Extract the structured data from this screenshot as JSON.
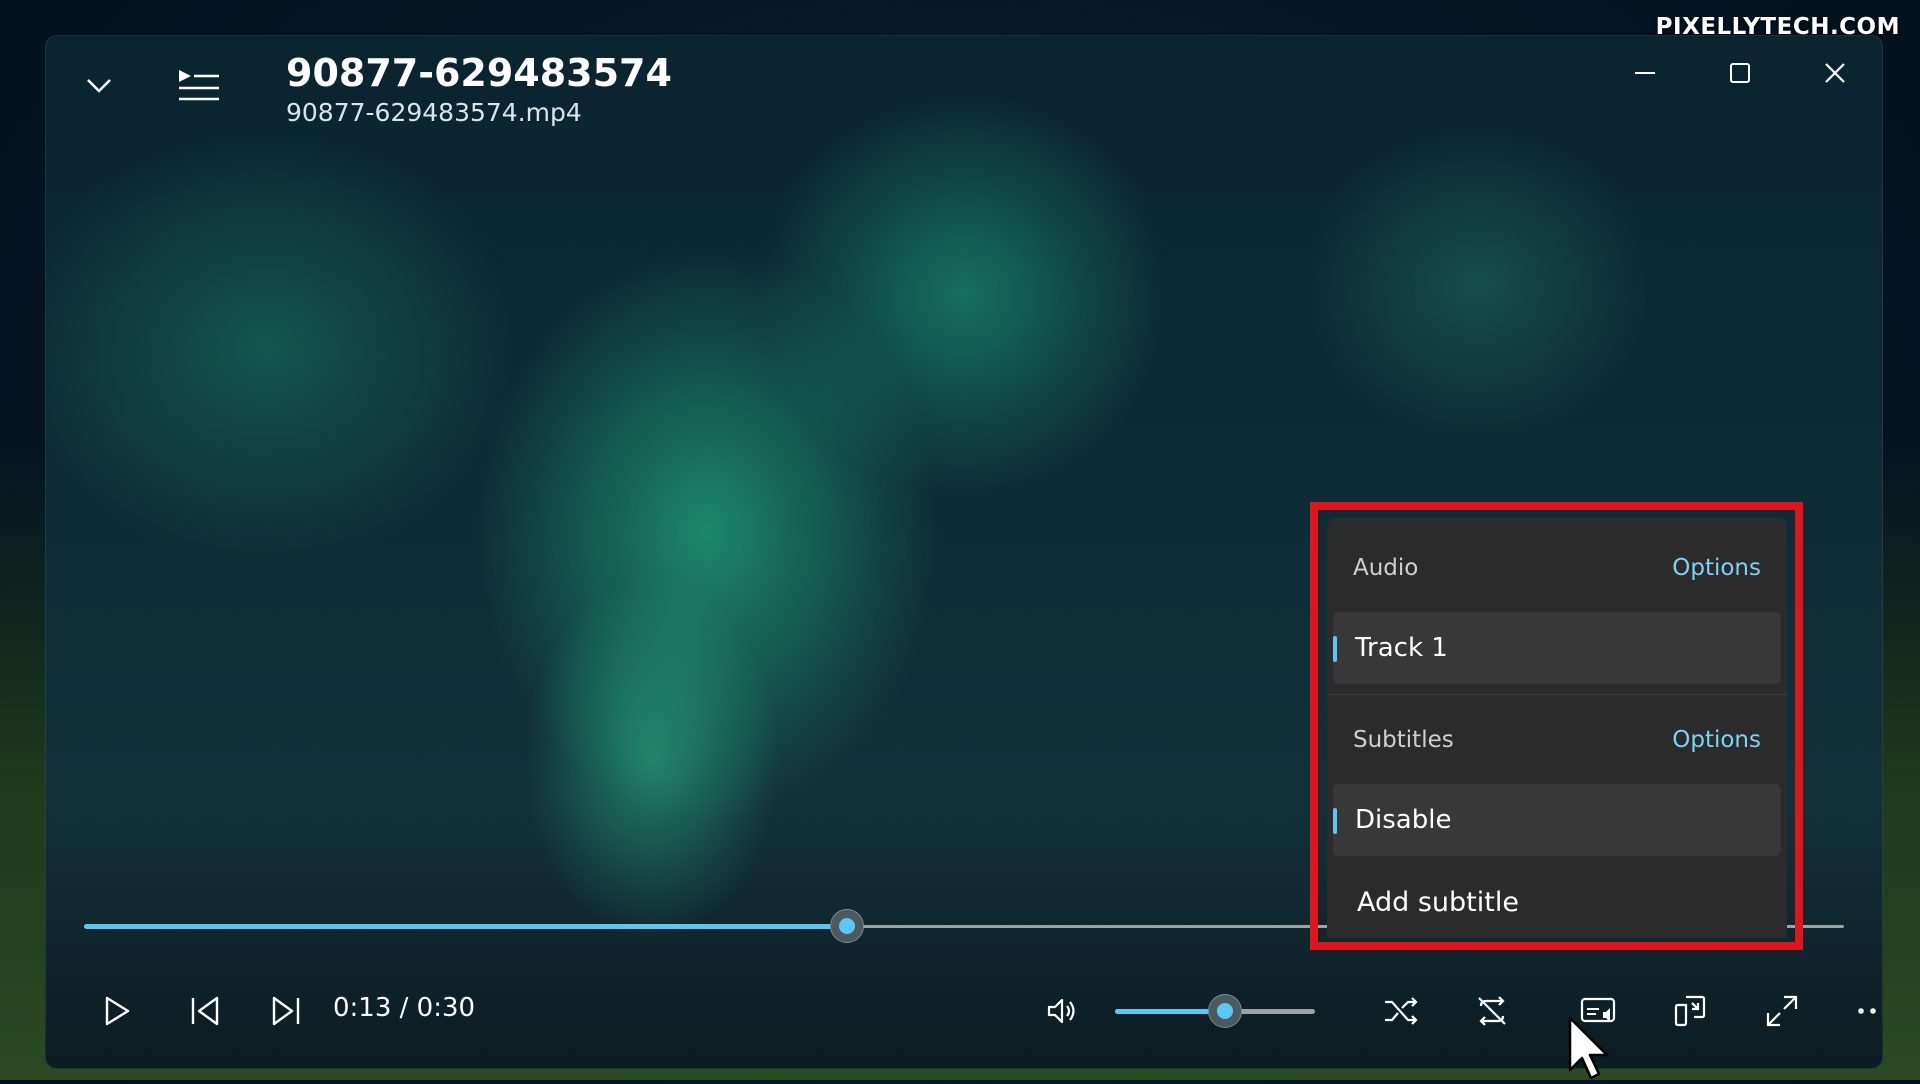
{
  "watermark": "PIXELLYTECH.COM",
  "window": {
    "title": "90877-629483574",
    "filename": "90877-629483574.mp4"
  },
  "playback": {
    "time_display": "0:13 / 0:30",
    "progress_fraction": 0.4333,
    "volume_fraction": 0.55
  },
  "menu": {
    "audio": {
      "label": "Audio",
      "options_label": "Options",
      "tracks": [
        "Track 1"
      ],
      "selected": "Track 1"
    },
    "subtitles": {
      "label": "Subtitles",
      "options_label": "Options",
      "items": [
        "Disable"
      ],
      "selected": "Disable",
      "add_label": "Add subtitle"
    }
  },
  "colors": {
    "accent": "#5cc7f2",
    "highlight_box": "#e0141c",
    "menu_bg": "#2b2b2b"
  },
  "icons": {
    "collapse": "chevron-down-icon",
    "playlist": "playlist-icon",
    "minimize": "minimize-icon",
    "maximize": "maximize-icon",
    "close": "close-icon",
    "play": "play-icon",
    "previous": "skip-previous-icon",
    "next": "skip-next-icon",
    "volume": "volume-icon",
    "shuffle": "shuffle-icon",
    "repeat": "repeat-off-icon",
    "audio_subtitles": "subtitles-audio-icon",
    "mini_view": "mini-view-icon",
    "fullscreen": "fullscreen-icon",
    "more": "more-options-icon"
  }
}
